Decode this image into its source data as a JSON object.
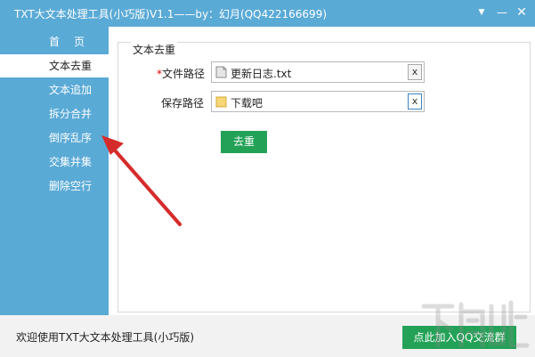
{
  "window": {
    "title": "TXT大文本处理工具(小巧版)V1.1——by：幻月(QQ422166699)",
    "menu_icon": "dropdown-icon",
    "min_symbol": "—",
    "close_symbol": "✕"
  },
  "sidebar": {
    "items": [
      {
        "label": "首页",
        "active": false
      },
      {
        "label": "文本去重",
        "active": true
      },
      {
        "label": "文本追加",
        "active": false
      },
      {
        "label": "拆分合并",
        "active": false
      },
      {
        "label": "倒序乱序",
        "active": false
      },
      {
        "label": "交集并集",
        "active": false
      },
      {
        "label": "删除空行",
        "active": false
      }
    ]
  },
  "main": {
    "group_title": "文本去重",
    "file_path": {
      "required_mark": "*",
      "label": "文件路径",
      "value": "更新日志.txt"
    },
    "save_path": {
      "label": "保存路径",
      "value": "下载吧"
    },
    "clear_symbol": "x",
    "dedupe_button": "去重"
  },
  "status": {
    "text": "欢迎使用TXT大文本处理工具(小巧版)",
    "join_button": "点此加入QQ交流群"
  },
  "colors": {
    "accent_blue": "#5aaad6",
    "button_green": "#23a257",
    "arrow_red": "#d62b2b"
  }
}
